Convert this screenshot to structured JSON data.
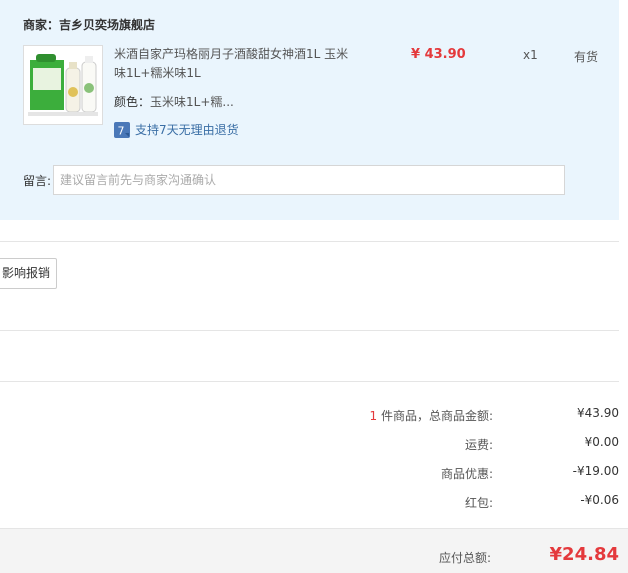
{
  "order": {
    "merchant_label": "商家：吉乡贝奕场旗舰店",
    "product": {
      "title": "米酒自家产玛格丽月子酒酸甜女神酒1L 玉米味1L+糯米味1L",
      "price": "¥ 43.90",
      "quantity": "x1",
      "stock_status": "有货",
      "variant_label": "颜色：",
      "variant_value": "玉米味1L+糯...",
      "policy_badge": "7",
      "policy_text": "支持7天无理由退货"
    },
    "note": {
      "label": "留言:",
      "placeholder": "建议留言前先与商家沟通确认"
    }
  },
  "invoice": {
    "button_label": "影响报销"
  },
  "summary": {
    "item_count": "1",
    "items_total_label": " 件商品，总商品金额:",
    "items_total_value": "¥43.90",
    "shipping_label": "运费:",
    "shipping_value": "¥0.00",
    "discount_label": "商品优惠:",
    "discount_value": "-¥19.00",
    "redpacket_label": "红包:",
    "redpacket_value": "-¥0.06",
    "payable_label": "应付总额:",
    "payable_value": "¥24.84"
  },
  "colors": {
    "accent_red": "#e4393c",
    "card_bg": "#eaf5fd",
    "link_blue": "#3a6ea5"
  }
}
